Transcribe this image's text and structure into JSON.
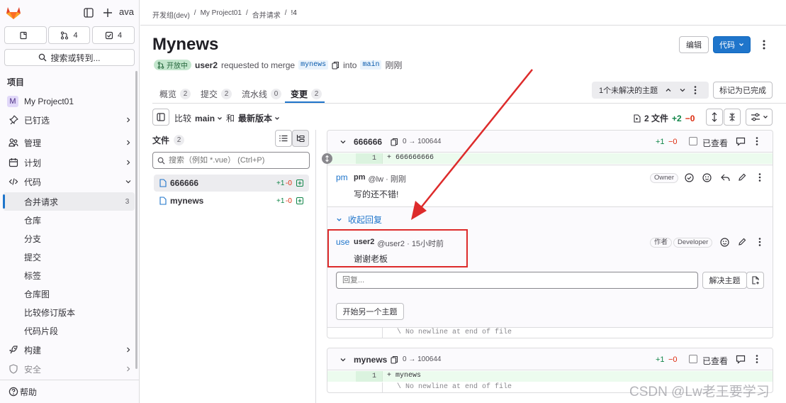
{
  "sidebar": {
    "avatar_text": "ava",
    "counters": {
      "issues": "",
      "merge_requests": "4",
      "todos": "4"
    },
    "search_label": "搜索或转到...",
    "section_title": "项目",
    "project": {
      "letter": "M",
      "name": "My Project01"
    },
    "items": [
      {
        "label": "已钉选"
      },
      {
        "label": "管理"
      },
      {
        "label": "计划"
      },
      {
        "label": "代码"
      }
    ],
    "code_sub": [
      {
        "label": "合并请求",
        "count": "3"
      },
      {
        "label": "仓库"
      },
      {
        "label": "分支"
      },
      {
        "label": "提交"
      },
      {
        "label": "标签"
      },
      {
        "label": "仓库图"
      },
      {
        "label": "比较修订版本"
      },
      {
        "label": "代码片段"
      }
    ],
    "build_label": "构建",
    "security_label": "安全",
    "help_label": "帮助"
  },
  "breadcrumb": [
    "开发组(dev)",
    "My Project01",
    "合并请求",
    "!4"
  ],
  "mr": {
    "title": "Mynews",
    "status": "开放中",
    "author": "user2",
    "requested_text": "requested to merge",
    "source_branch": "mynews",
    "into_text": "into",
    "target_branch": "main",
    "time": "刚刚",
    "edit_label": "编辑",
    "code_label": "代码"
  },
  "tabs": [
    {
      "label": "概览",
      "count": "2"
    },
    {
      "label": "提交",
      "count": "2"
    },
    {
      "label": "流水线",
      "count": "0"
    },
    {
      "label": "变更",
      "count": "2"
    }
  ],
  "threads": {
    "unresolved_label": "1个未解决的主题",
    "mark_done_label": "标记为已完成"
  },
  "compare": {
    "label": "比较",
    "base": "main",
    "and": "和",
    "head": "最新版本"
  },
  "stats": {
    "files": "2 文件",
    "added": "+2",
    "removed": "−0"
  },
  "tree": {
    "title": "文件",
    "count": "2",
    "search_placeholder": "搜索（例如 *.vue） (Ctrl+P)",
    "files": [
      {
        "name": "666666",
        "stat_add": "+1",
        "stat_del": "-0"
      },
      {
        "name": "mynews",
        "stat_add": "+1",
        "stat_del": "-0"
      }
    ]
  },
  "diff1": {
    "file": "666666",
    "mode": "0 → 100644",
    "added": "+1",
    "removed": "−0",
    "viewed_label": "已查看",
    "line_num": "1",
    "line_text": "+  666666666",
    "no_newline": "\\ No newline at end of file",
    "note1": {
      "avatar": "pm",
      "author": "pm",
      "handle": "@lw · 刚刚",
      "role": "Owner",
      "text": "写的还不错!"
    },
    "collapse_label": "收起回复",
    "note2": {
      "avatar": "use",
      "author": "user2",
      "handle": "@user2 · 15小时前",
      "author_badge": "作者",
      "role": "Developer",
      "text": "谢谢老板"
    },
    "reply_placeholder": "回复...",
    "resolve_label": "解决主题",
    "new_thread_label": "开始另一个主题"
  },
  "diff2": {
    "file": "mynews",
    "mode": "0 → 100644",
    "added": "+1",
    "removed": "−0",
    "viewed_label": "已查看",
    "line_num": "1",
    "line_text": "+  mynews",
    "no_newline": "\\ No newline at end of file"
  },
  "watermark": "CSDN @Lw老王要学习",
  "colors": {
    "accent": "#1f75cb",
    "added": "#108548",
    "removed": "#dd2b0e",
    "annotation": "#dd2b2b"
  }
}
